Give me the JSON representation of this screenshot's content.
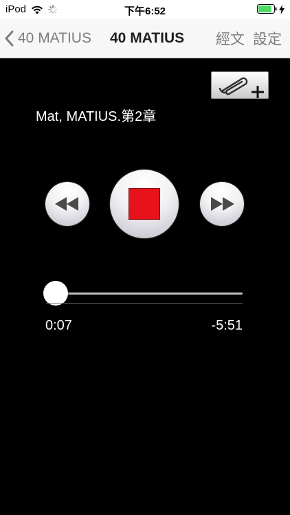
{
  "status_bar": {
    "carrier": "iPod",
    "time": "下午6:52",
    "battery_level": 0.85,
    "icons": [
      "wifi-icon",
      "activity-spinner-icon",
      "battery-icon",
      "charging-bolt-icon"
    ]
  },
  "nav": {
    "back_label": "40 MATIUS",
    "title": "40 MATIUS",
    "actions": [
      "經文",
      "設定"
    ]
  },
  "player": {
    "attach_icon": "paperclip-plus-icon",
    "track_title": "Mat, MATIUS.第2章",
    "controls": [
      "rewind-icon",
      "stop-icon",
      "fast-forward-icon"
    ],
    "elapsed": "0:07",
    "remaining": "-5:51",
    "progress_fraction": 0.02
  },
  "colors": {
    "background": "#000000",
    "nav_background": "#f7f7f7",
    "stop_red": "#e8121c",
    "progress_blue": "#1e6fe0",
    "battery_green": "#4cd964"
  }
}
